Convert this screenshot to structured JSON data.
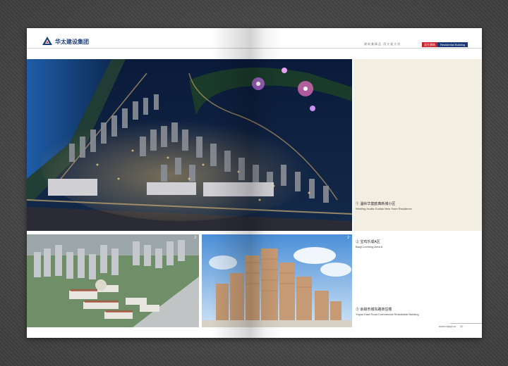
{
  "header": {
    "company_name": "华太建设集团",
    "slogan": "建筑美精品    用大爱大恒",
    "category_cn": "居住建筑",
    "category_en": "Residential Building"
  },
  "colors": {
    "brand_blue": "#1f3f7a",
    "brand_red": "#c8202a",
    "panel_beige": "#f3eee2",
    "backdrop": "#4a4a4a"
  },
  "photos": {
    "main": {
      "index": "1"
    },
    "bottom_left": {
      "index": "2"
    },
    "bottom_right": {
      "index": "2"
    }
  },
  "captions": [
    {
      "num": "①",
      "cn": "温岭华富欧典新城小区",
      "en": "Wenling Huafu Oudian New Town Residence"
    },
    {
      "num": "②",
      "cn": "宝鸡乐成A区",
      "en": "Baoji Locheng Area A"
    },
    {
      "num": "③",
      "cn": "余姚市城东路商住楼",
      "en": "Yuyao East Road Commercial Residential Building"
    }
  ],
  "footer": {
    "url": "www.hbjsjt.cn",
    "page": "32"
  }
}
